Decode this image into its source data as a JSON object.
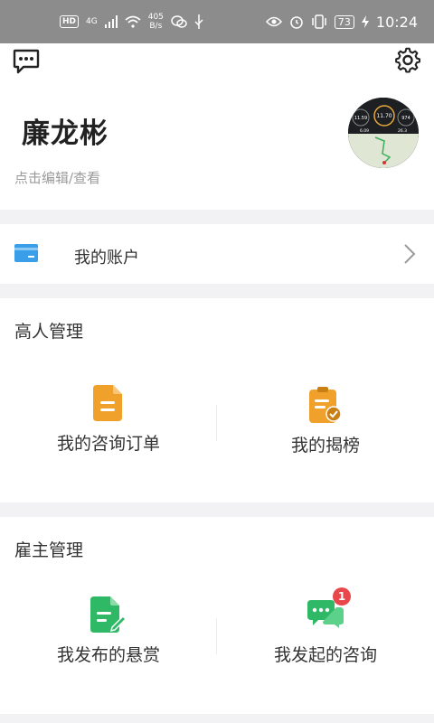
{
  "status_bar": {
    "hd": "HD",
    "network": "4G",
    "speed_value": "405",
    "speed_unit": "B/s",
    "battery": "73",
    "time": "10:24"
  },
  "header": {
    "user_name": "廉龙彬",
    "edit_hint": "点击编辑/查看",
    "avatar_stats": [
      "11.59",
      "11.70",
      "974",
      "6.09",
      "26.3"
    ]
  },
  "account": {
    "label": "我的账户"
  },
  "expert_section": {
    "title": "高人管理",
    "items": [
      {
        "label": "我的咨询订单",
        "icon": "document-icon"
      },
      {
        "label": "我的揭榜",
        "icon": "clipboard-check-icon"
      }
    ]
  },
  "employer_section": {
    "title": "雇主管理",
    "items": [
      {
        "label": "我发布的悬赏",
        "icon": "edit-document-icon"
      },
      {
        "label": "我发起的咨询",
        "icon": "chat-bubbles-icon",
        "badge": "1"
      }
    ]
  },
  "colors": {
    "orange": "#f0a12b",
    "green": "#2fb866",
    "badge_red": "#e8484c",
    "card_blue": "#3a9ee8"
  }
}
